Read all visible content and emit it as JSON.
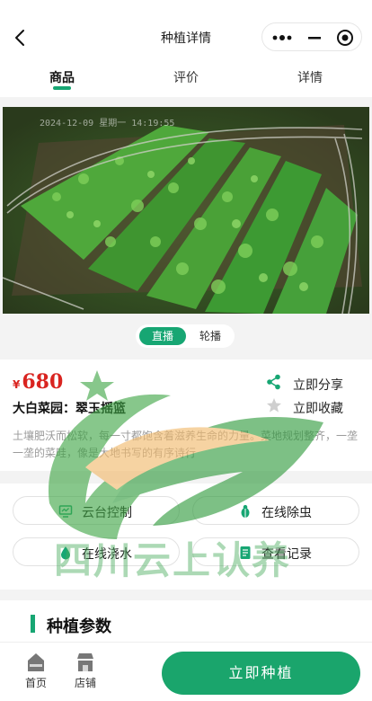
{
  "nav": {
    "title": "种植详情"
  },
  "tabs": [
    {
      "label": "商品",
      "active": true
    },
    {
      "label": "评价",
      "active": false
    },
    {
      "label": "详情",
      "active": false
    }
  ],
  "photo": {
    "timestamp": "2024-12-09 星期一 14:19:55"
  },
  "view_switch": {
    "live": "直播",
    "carousel": "轮播",
    "selected": "直播"
  },
  "product": {
    "currency": "¥",
    "price": "680",
    "name": "大白菜园：翠玉摇篮",
    "description": "土壤肥沃而松软，每一寸都饱含着滋养生命的力量。菜地规划整齐，一垄一垄的菜畦，像是大地书写的有序诗行",
    "share_label": "立即分享",
    "favorite_label": "立即收藏"
  },
  "operations": [
    {
      "label": "云台控制",
      "icon": "monitor-icon"
    },
    {
      "label": "在线除虫",
      "icon": "bug-icon"
    },
    {
      "label": "在线浇水",
      "icon": "water-drop-icon"
    },
    {
      "label": "查看记录",
      "icon": "record-icon"
    }
  ],
  "params": {
    "title": "种植参数"
  },
  "bottom_bar": {
    "home_label": "首页",
    "shop_label": "店铺",
    "plant_button": "立即种植"
  },
  "watermark": {
    "text": "四川云上认养"
  },
  "colors": {
    "accent": "#17a673",
    "price": "#d92420"
  }
}
